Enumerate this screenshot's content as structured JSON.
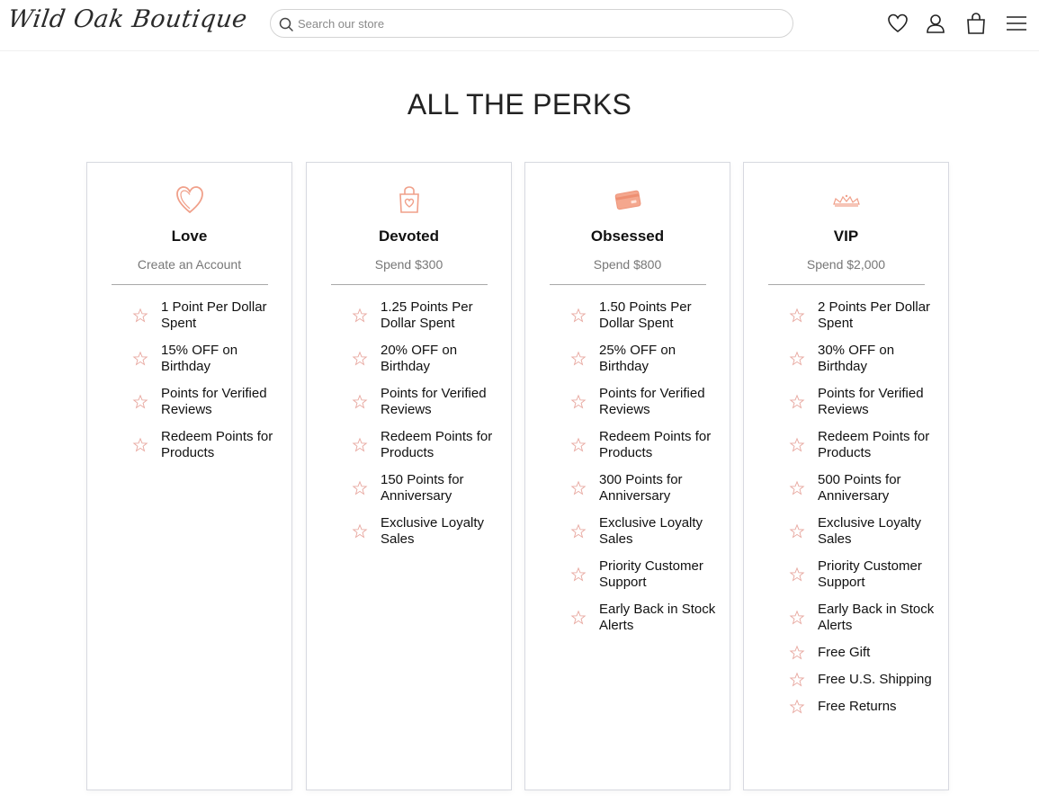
{
  "header": {
    "logo": "Wild Oak Boutique",
    "search_placeholder": "Search our store"
  },
  "page_title": "ALL THE PERKS",
  "colors": {
    "accent": "#f0a08a",
    "star": "#e8a8a0"
  },
  "tiers": [
    {
      "name": "Love",
      "requirement": "Create an Account",
      "icon": "heart-icon",
      "perks": [
        "1 Point Per Dollar Spent",
        "15% OFF on Birthday",
        "Points for Verified Reviews",
        "Redeem Points for Products"
      ]
    },
    {
      "name": "Devoted",
      "requirement": "Spend $300",
      "icon": "shopping-bag-icon",
      "perks": [
        "1.25 Points Per Dollar Spent",
        "20% OFF on Birthday",
        "Points for Verified Reviews",
        "Redeem Points for Products",
        "150 Points for Anniversary",
        "Exclusive Loyalty Sales"
      ]
    },
    {
      "name": "Obsessed",
      "requirement": "Spend $800",
      "icon": "credit-card-icon",
      "perks": [
        "1.50 Points Per Dollar Spent",
        "25% OFF on Birthday",
        "Points for Verified Reviews",
        "Redeem Points for Products",
        "300 Points for Anniversary",
        "Exclusive Loyalty Sales",
        "Priority Customer Support",
        "Early Back in Stock Alerts"
      ]
    },
    {
      "name": "VIP",
      "requirement": "Spend $2,000",
      "icon": "crown-icon",
      "perks": [
        "2 Points Per Dollar Spent",
        "30% OFF on Birthday",
        "Points for Verified Reviews",
        "Redeem Points for Products",
        "500 Points for Anniversary",
        "Exclusive Loyalty Sales",
        "Priority Customer Support",
        "Early Back in Stock Alerts",
        "Free Gift",
        "Free U.S. Shipping",
        "Free Returns"
      ]
    }
  ]
}
